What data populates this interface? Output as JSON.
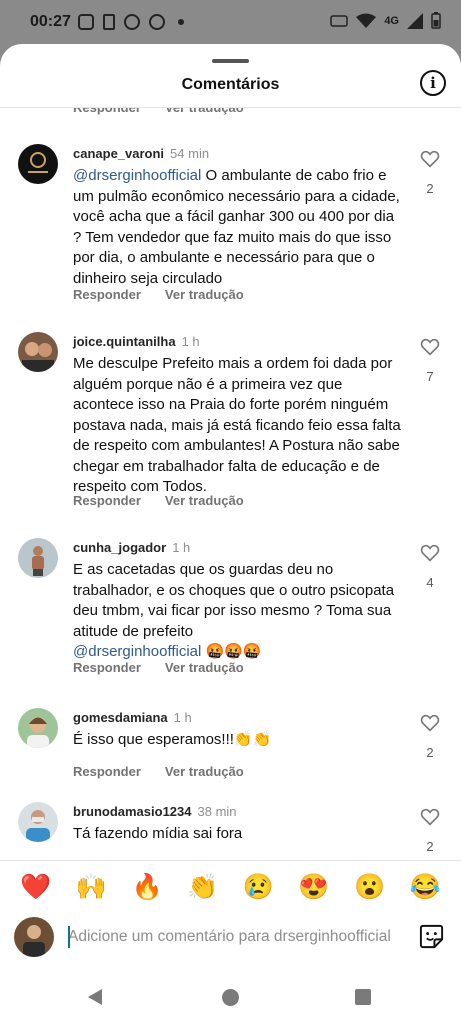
{
  "status": {
    "time": "00:27",
    "net_label": "4G"
  },
  "sheet": {
    "title": "Comentários"
  },
  "actions": {
    "reply": "Responder",
    "translate": "Ver tradução"
  },
  "comments": [
    {
      "user": "canape_varoni",
      "time": "54 min",
      "mention": "@drserginhoofficial",
      "text": " O ambulante de cabo frio e um pulmão econômico necessário para a cidade, você acha que a fácil ganhar 300 ou 400 por dia ? Tem vendedor que faz muito mais do que isso por dia, o ambulante e necessário para que o dinheiro seja circulado",
      "likes": "2"
    },
    {
      "user": "joice.quintanilha",
      "time": "1 h",
      "text": "Me desculpe Prefeito mais a ordem foi dada por alguém porque não é a primeira vez que acontece isso na Praia do forte porém ninguém postava nada, mais já está ficando feio essa falta de respeito com ambulantes! A Postura não sabe chegar em trabalhador falta de educação e de respeito com Todos.",
      "likes": "7"
    },
    {
      "user": "cunha_jogador",
      "time": "1 h",
      "text": "E as cacetadas que os guardas deu no trabalhador, e os choques que o outro psicopata deu tmbm, vai ficar por isso mesmo ? Toma sua atitude de prefeito",
      "mention": "@drserginhoofficial",
      "emoji": " 🤬🤬🤬",
      "likes": "4"
    },
    {
      "user": "gomesdamiana",
      "time": "1 h",
      "text": "É isso que esperamos!!!👏👏",
      "likes": "2"
    },
    {
      "user": "brunodamasio1234",
      "time": "38 min",
      "text": "Tá fazendo mídia sai fora",
      "likes": "2"
    }
  ],
  "reactions": [
    "❤️",
    "🙌",
    "🔥",
    "👏",
    "😢",
    "😍",
    "😮",
    "😂"
  ],
  "composer": {
    "placeholder": "Adicione um comentário para drserginhoofficial"
  },
  "icons": {
    "info": "info-icon",
    "heart": "heart-icon",
    "sticker": "sticker-icon",
    "back": "back-icon",
    "home": "home-icon",
    "recent": "recent-apps-icon"
  },
  "colors": {
    "mention": "#2f5a8a",
    "muted": "#737373",
    "background_dim": "#8a8a8a"
  }
}
